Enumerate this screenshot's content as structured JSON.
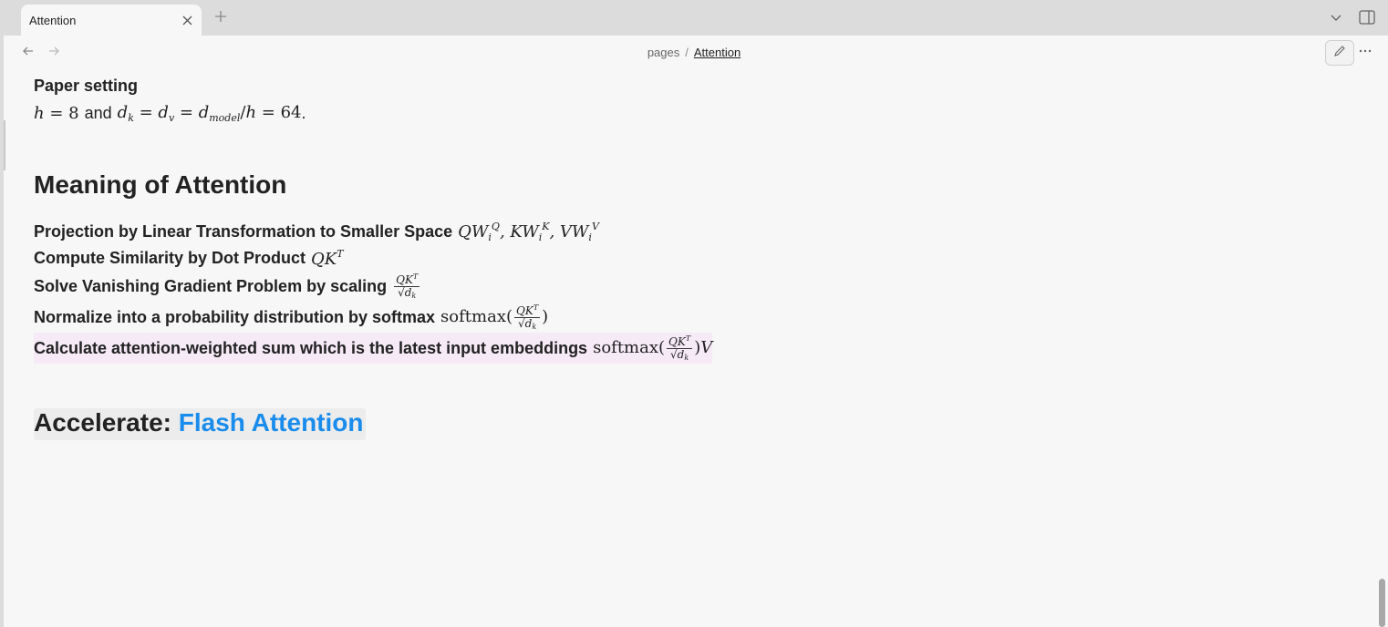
{
  "tab": {
    "title": "Attention"
  },
  "breadcrumb": {
    "parent": "pages",
    "separator": "/",
    "current": "Attention"
  },
  "doc": {
    "paper_setting": {
      "heading": "Paper setting",
      "and_word": "and",
      "trail": "."
    },
    "meaning_heading": "Meaning of Attention",
    "steps": [
      "Projection by Linear Transformation to Smaller Space",
      "Compute Similarity by Dot Product",
      "Solve Vanishing Gradient Problem by scaling",
      "Normalize into a probability distribution by softmax",
      "Calculate attention-weighted sum which is the latest input embeddings"
    ],
    "softmax_word": "softmax",
    "accel_heading": {
      "prefix": "Accelerate: ",
      "link": "Flash Attention"
    }
  },
  "colors": {
    "link": "#1a8cec",
    "highlight": "#f6eaf7"
  },
  "icons": [
    "close-icon",
    "plus-icon",
    "chevron-down-icon",
    "sidebar-toggle-icon",
    "arrow-left-icon",
    "arrow-right-icon",
    "pencil-icon",
    "more-icon"
  ]
}
